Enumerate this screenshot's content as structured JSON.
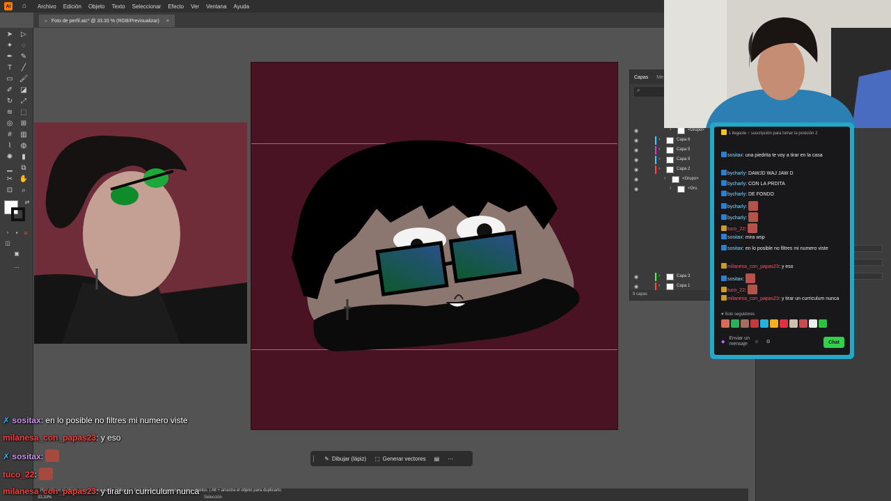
{
  "menubar": {
    "logo": "Ai",
    "items": [
      "Archivo",
      "Edición",
      "Objeto",
      "Texto",
      "Seleccionar",
      "Efecto",
      "Ver",
      "Ventana",
      "Ayuda"
    ]
  },
  "document_tab": {
    "title": "Foto de perfil.aic* @ 33.33 % (RGB/Previsualizar)",
    "close": "×"
  },
  "layers_panel": {
    "tabs": [
      "Capas",
      "Me"
    ],
    "layers": [
      {
        "name": "<Grupo>",
        "indent": 2
      },
      {
        "name": "Capa 6",
        "color": "#4ec7ff"
      },
      {
        "name": "Capa 5",
        "color": "#d43fd6"
      },
      {
        "name": "Capa 9",
        "color": "#4ec7ff"
      },
      {
        "name": "Capa 2",
        "color": "#ff4a4a"
      },
      {
        "name": "<Grupo>",
        "indent": 1
      },
      {
        "name": "<Gru",
        "indent": 2
      },
      {
        "name": "Capa 3",
        "color": "#4aff4a"
      },
      {
        "name": "Capa 1",
        "color": "#ff4a4a"
      }
    ],
    "footer": "9 capas"
  },
  "chat": {
    "top_notice": "llegaste ↑ suscripción para tomar la posición 2",
    "top_count": "1",
    "messages": [
      {
        "user": "sositax",
        "text": "una piedrita te voy a tirar en la casa",
        "user_color": "#8bd8ff"
      },
      {
        "user": "bycharly",
        "text": "DAWJD WAJ JAW D",
        "user_color": "#8bd8ff"
      },
      {
        "user": "bycharly",
        "text": "CON LA PRDITA",
        "user_color": "#8bd8ff"
      },
      {
        "user": "bycharly",
        "text": "DE FONDO",
        "user_color": "#8bd8ff"
      },
      {
        "user": "bycharly",
        "text": "",
        "user_color": "#8bd8ff",
        "emote": true
      },
      {
        "user": "bycharly",
        "text": "",
        "user_color": "#8bd8ff",
        "emote": true
      },
      {
        "user": "tuco_22",
        "text": "",
        "user_color": "#ff4f6e",
        "emote": true
      },
      {
        "user": "sositax",
        "text": "mira wsp",
        "user_color": "#8bd8ff"
      },
      {
        "user": "sositax",
        "text": "en lo posible no filtres mi numero viste",
        "user_color": "#8bd8ff"
      },
      {
        "user": "milanesa_con_papas23",
        "text": "y eso",
        "user_color": "#ff4f6e"
      },
      {
        "user": "sositax",
        "text": "",
        "user_color": "#8bd8ff",
        "emote": true
      },
      {
        "user": "tuco_22",
        "text": "",
        "user_color": "#ff4f6e",
        "emote": true
      },
      {
        "user": "milanesa_con_papas23",
        "text": "y tirar un curriculum nunca",
        "user_color": "#ff4f6e"
      }
    ],
    "followers_only": "Solo seguidores",
    "input_placeholder": "Enviar un mensaje",
    "chat_button": "Chat"
  },
  "context_bar": {
    "draw_button": "Dibujar (lápiz)",
    "vectorize_button": "Generar vectores"
  },
  "overlay_chat": [
    {
      "user": "sositax",
      "text": "en lo posible no filtres mi numero viste",
      "style": "u1"
    },
    {
      "user": "milanesa_con_papas23",
      "text": "y eso",
      "style": "u2"
    },
    {
      "user": "sositax",
      "text": "",
      "style": "u1",
      "emote": true
    },
    {
      "user": "tuco_22",
      "text": "",
      "style": "u2",
      "emote": true
    },
    {
      "user": "milanesa_con_papas23",
      "text": "y tirar un curriculum nunca",
      "style": "u2"
    }
  ],
  "statusbar": {
    "hint": "Haz clic en el objeto para seleccionarlo. | Mayús + haz clic para seleccionar varios objetos. | Alt + arrastra el objeto para duplicarlo.",
    "zoom": "33,33%",
    "mode": "Selección"
  },
  "colors": {
    "artboard": "#4a1323",
    "chat_frame": "#23a8c7",
    "chat_button": "#2fd34a"
  }
}
